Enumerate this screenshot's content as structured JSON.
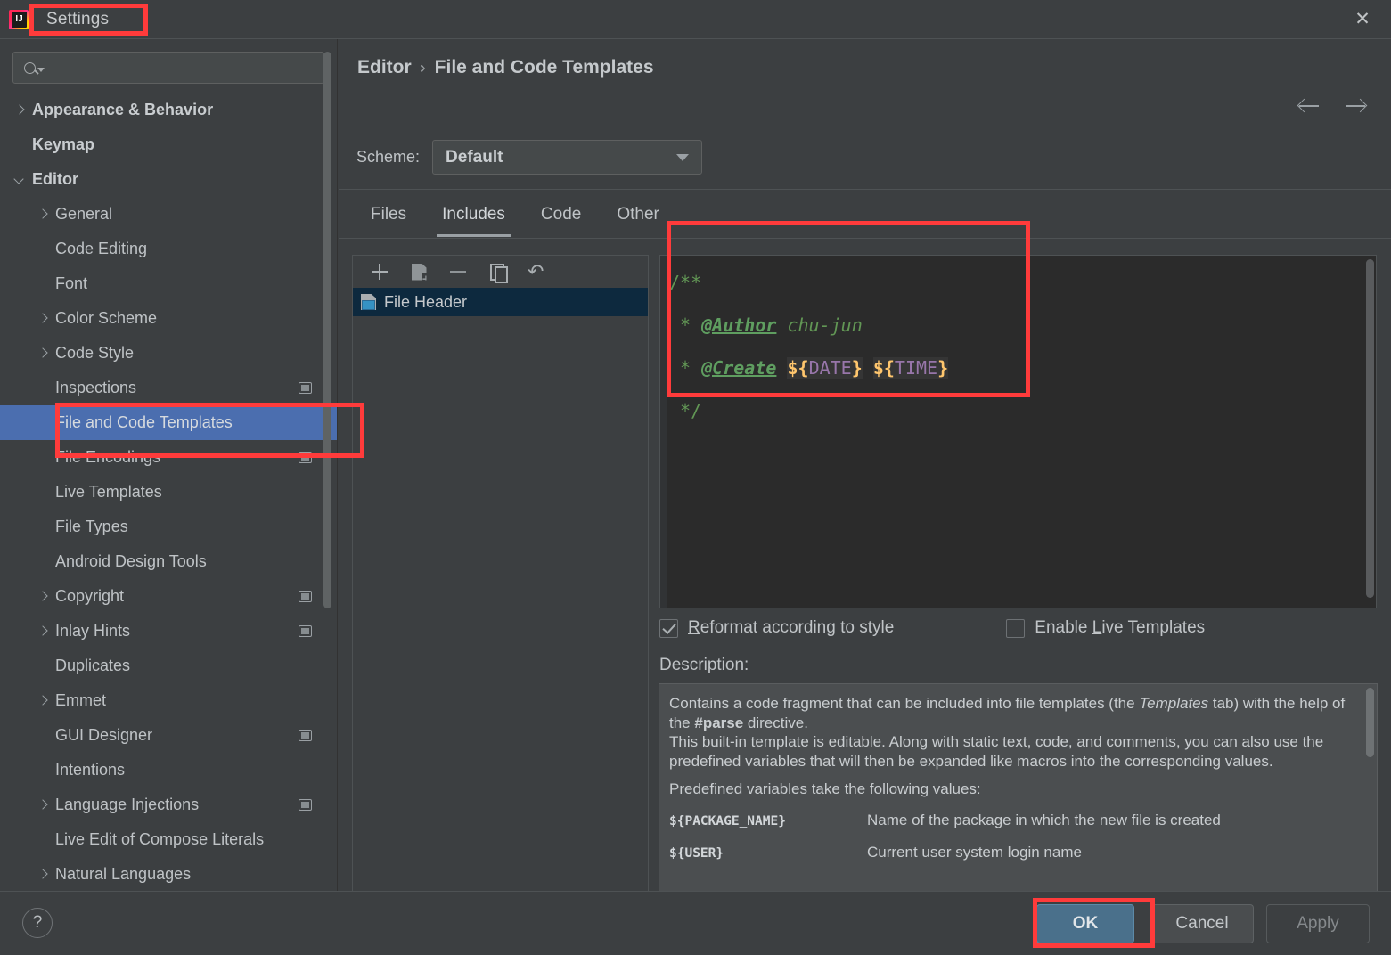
{
  "window": {
    "title": "Settings",
    "logo_icon": "intellij-idea-logo",
    "close_icon": "close-icon"
  },
  "sidebar": {
    "search": {
      "placeholder": "",
      "value": "",
      "icon": "search-icon"
    },
    "items": [
      {
        "label": "Appearance & Behavior",
        "arrow": "right",
        "bold": true,
        "indent": 0,
        "badge": false,
        "selected": false
      },
      {
        "label": "Keymap",
        "arrow": "none",
        "bold": true,
        "indent": 0,
        "badge": false,
        "selected": false
      },
      {
        "label": "Editor",
        "arrow": "down",
        "bold": true,
        "indent": 0,
        "badge": false,
        "selected": false
      },
      {
        "label": "General",
        "arrow": "right",
        "bold": false,
        "indent": 1,
        "badge": false,
        "selected": false
      },
      {
        "label": "Code Editing",
        "arrow": "none",
        "bold": false,
        "indent": 1,
        "badge": false,
        "selected": false
      },
      {
        "label": "Font",
        "arrow": "none",
        "bold": false,
        "indent": 1,
        "badge": false,
        "selected": false
      },
      {
        "label": "Color Scheme",
        "arrow": "right",
        "bold": false,
        "indent": 1,
        "badge": false,
        "selected": false
      },
      {
        "label": "Code Style",
        "arrow": "right",
        "bold": false,
        "indent": 1,
        "badge": false,
        "selected": false
      },
      {
        "label": "Inspections",
        "arrow": "none",
        "bold": false,
        "indent": 1,
        "badge": true,
        "selected": false
      },
      {
        "label": "File and Code Templates",
        "arrow": "none",
        "bold": false,
        "indent": 1,
        "badge": false,
        "selected": true
      },
      {
        "label": "File Encodings",
        "arrow": "none",
        "bold": false,
        "indent": 1,
        "badge": true,
        "selected": false
      },
      {
        "label": "Live Templates",
        "arrow": "none",
        "bold": false,
        "indent": 1,
        "badge": false,
        "selected": false
      },
      {
        "label": "File Types",
        "arrow": "none",
        "bold": false,
        "indent": 1,
        "badge": false,
        "selected": false
      },
      {
        "label": "Android Design Tools",
        "arrow": "none",
        "bold": false,
        "indent": 1,
        "badge": false,
        "selected": false
      },
      {
        "label": "Copyright",
        "arrow": "right",
        "bold": false,
        "indent": 1,
        "badge": true,
        "selected": false
      },
      {
        "label": "Inlay Hints",
        "arrow": "right",
        "bold": false,
        "indent": 1,
        "badge": true,
        "selected": false
      },
      {
        "label": "Duplicates",
        "arrow": "none",
        "bold": false,
        "indent": 1,
        "badge": false,
        "selected": false
      },
      {
        "label": "Emmet",
        "arrow": "right",
        "bold": false,
        "indent": 1,
        "badge": false,
        "selected": false
      },
      {
        "label": "GUI Designer",
        "arrow": "none",
        "bold": false,
        "indent": 1,
        "badge": true,
        "selected": false
      },
      {
        "label": "Intentions",
        "arrow": "none",
        "bold": false,
        "indent": 1,
        "badge": false,
        "selected": false
      },
      {
        "label": "Language Injections",
        "arrow": "right",
        "bold": false,
        "indent": 1,
        "badge": true,
        "selected": false
      },
      {
        "label": "Live Edit of Compose Literals",
        "arrow": "none",
        "bold": false,
        "indent": 1,
        "badge": false,
        "selected": false
      },
      {
        "label": "Natural Languages",
        "arrow": "right",
        "bold": false,
        "indent": 1,
        "badge": false,
        "selected": false
      }
    ]
  },
  "main": {
    "breadcrumb": {
      "parent": "Editor",
      "separator": "›",
      "current": "File and Code Templates"
    },
    "nav": {
      "back_icon": "arrow-left-icon",
      "forward_icon": "arrow-right-icon"
    },
    "scheme": {
      "label": "Scheme:",
      "value": "Default",
      "dropdown_icon": "chevron-down-icon"
    },
    "tabs": [
      {
        "label": "Files",
        "active": false
      },
      {
        "label": "Includes",
        "active": true
      },
      {
        "label": "Code",
        "active": false
      },
      {
        "label": "Other",
        "active": false
      }
    ],
    "list_toolbar": [
      {
        "icon": "plus-icon",
        "name": "add-template-button"
      },
      {
        "icon": "page-plus-icon",
        "name": "create-template-from-file-button"
      },
      {
        "icon": "minus-icon",
        "name": "remove-template-button"
      },
      {
        "icon": "copy-icon",
        "name": "copy-template-button"
      },
      {
        "icon": "undo-icon",
        "name": "reset-template-button"
      }
    ],
    "templates": [
      {
        "label": "File Header",
        "icon": "java-template-icon",
        "selected": true
      }
    ],
    "editor": {
      "lines": [
        {
          "segments": [
            {
              "text": "/**",
              "type": "comment"
            }
          ]
        },
        {
          "segments": [
            {
              "text": " * ",
              "type": "comment"
            },
            {
              "text": "@Author",
              "type": "tag"
            },
            {
              "text": " chu-jun",
              "type": "text"
            }
          ]
        },
        {
          "segments": [
            {
              "text": " * ",
              "type": "comment"
            },
            {
              "text": "@Create",
              "type": "tag"
            },
            {
              "text": " ",
              "type": "text"
            },
            {
              "text": "${DATE}",
              "type": "variable"
            },
            {
              "text": " ",
              "type": "text"
            },
            {
              "text": "${TIME}",
              "type": "variable"
            }
          ]
        },
        {
          "segments": [
            {
              "text": " */",
              "type": "comment"
            }
          ]
        }
      ],
      "plain_text": "/**\n * @Author chu-jun\n * @Create ${DATE} ${TIME}\n */"
    },
    "options": [
      {
        "label": "Reformat according to style",
        "checked": true,
        "mnemonic": "R"
      },
      {
        "label": "Enable Live Templates",
        "checked": false,
        "mnemonic": "L"
      }
    ],
    "description": {
      "label": "Description:",
      "paragraph1_a": "Contains a code fragment that can be included into file templates (the ",
      "paragraph1_italic": "Templates",
      "paragraph1_b": " tab) with the help of the ",
      "paragraph1_bold": "#parse",
      "paragraph1_c": " directive.",
      "paragraph2": "This built-in template is editable. Along with static text, code, and comments, you can also use the predefined variables that will then be expanded like macros into the corresponding values.",
      "variables_intro": "Predefined variables take the following values:",
      "variables": [
        {
          "name": "${PACKAGE_NAME}",
          "desc": "Name of the package in which the new file is created"
        },
        {
          "name": "${USER}",
          "desc": "Current user system login name"
        }
      ]
    }
  },
  "footer": {
    "help_icon": "question-mark-icon",
    "ok_label": "OK",
    "cancel_label": "Cancel",
    "apply_label": "Apply"
  },
  "annotations": {
    "color": "#ff3b3b",
    "boxes": [
      "settings-title",
      "file-and-code-templates-tree-item",
      "template-editor-content",
      "ok-button"
    ]
  },
  "colors": {
    "window_bg": "#3c3f41",
    "editor_bg": "#2b2b2b",
    "selection_blue": "#4b6eaf",
    "list_selection": "#0d293e",
    "ok_button": "#4a708b",
    "annotation_red": "#ff3b3b",
    "comment_green": "#629755",
    "variable_orange": "#ffc66d",
    "variable_purple": "#9876aa"
  }
}
